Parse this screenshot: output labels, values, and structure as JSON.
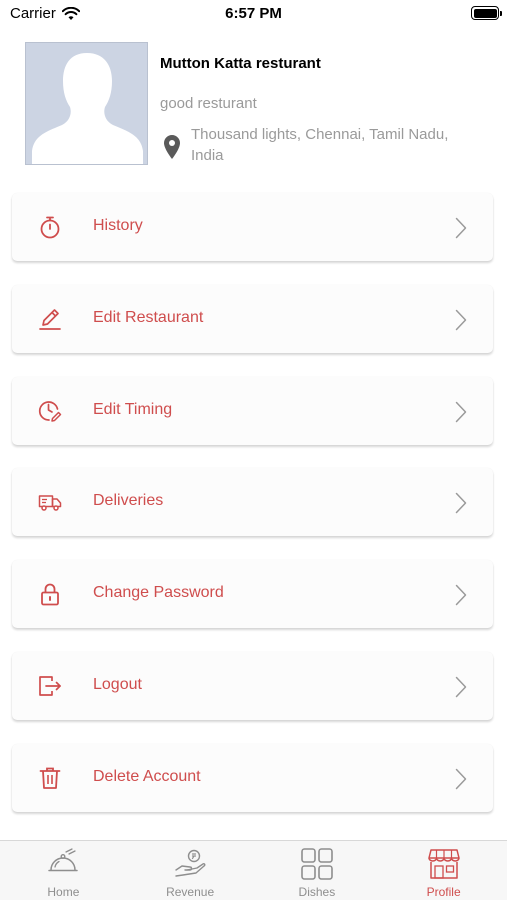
{
  "status_bar": {
    "carrier": "Carrier",
    "time": "6:57 PM"
  },
  "profile": {
    "name": "Mutton Katta resturant",
    "description": "good resturant",
    "location": "Thousand lights, Chennai, Tamil Nadu, India"
  },
  "menu": [
    {
      "label": "History",
      "icon": "stopwatch-icon"
    },
    {
      "label": "Edit Restaurant",
      "icon": "pencil-icon"
    },
    {
      "label": "Edit Timing",
      "icon": "clock-edit-icon"
    },
    {
      "label": "Deliveries",
      "icon": "delivery-truck-icon"
    },
    {
      "label": "Change Password",
      "icon": "lock-icon"
    },
    {
      "label": "Logout",
      "icon": "logout-icon"
    },
    {
      "label": "Delete Account",
      "icon": "trash-icon"
    }
  ],
  "tab_bar": {
    "tabs": [
      {
        "label": "Home",
        "icon": "cloche-icon"
      },
      {
        "label": "Revenue",
        "icon": "hand-money-icon"
      },
      {
        "label": "Dishes",
        "icon": "grid-icon"
      },
      {
        "label": "Profile",
        "icon": "storefront-icon"
      }
    ],
    "active": "Profile"
  },
  "colors": {
    "accent": "#cf4d4d",
    "muted_text": "#9a9a9a",
    "avatar_bg": "#ccd4e3",
    "avatar_fg": "#ffffff"
  }
}
